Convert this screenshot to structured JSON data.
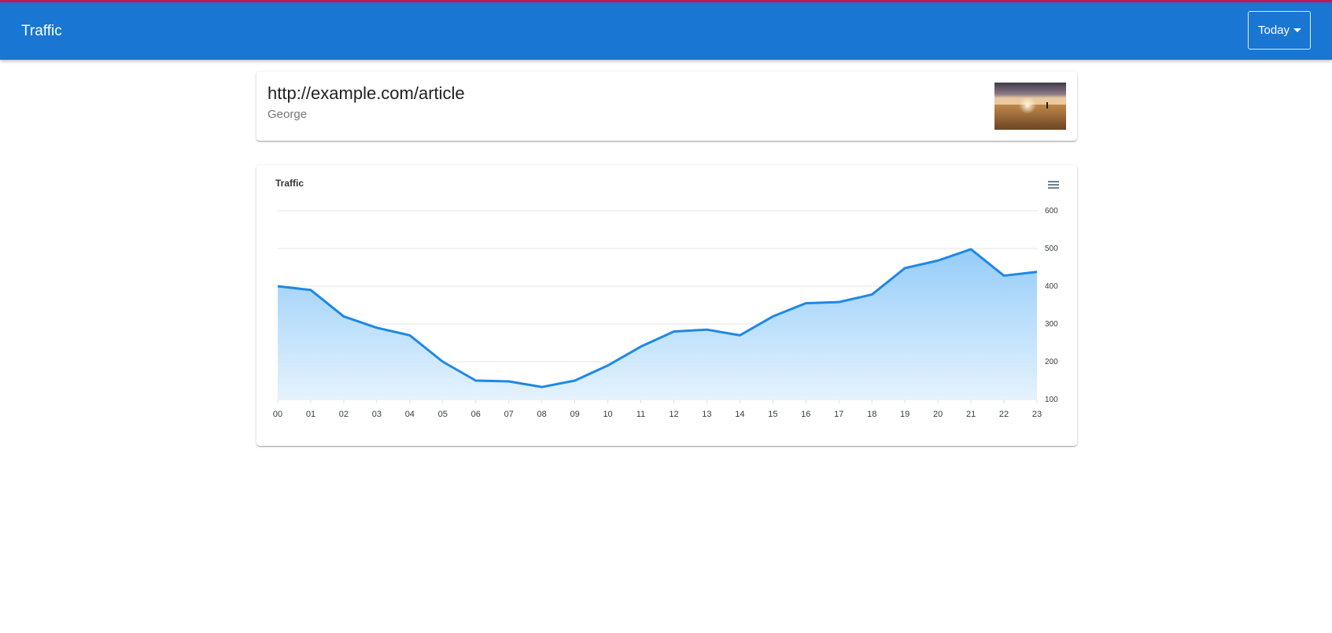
{
  "appbar": {
    "title": "Traffic",
    "range_select": {
      "value": "Today",
      "icon": "caret-down-icon"
    }
  },
  "article": {
    "url": "http://example.com/article",
    "author": "George",
    "thumbnail": "field-sunset-image"
  },
  "chart": {
    "menu_icon": "hamburger-menu-icon"
  },
  "colors": {
    "appbar": "#1976d2",
    "top_strip": "#c2185b",
    "series_line": "#1e88e5",
    "series_fill_top": "#90caf9",
    "series_fill_bottom": "#e3f2fd"
  },
  "chart_data": {
    "type": "area",
    "title": "Traffic",
    "xlabel": "",
    "ylabel": "",
    "categories": [
      "00",
      "01",
      "02",
      "03",
      "04",
      "05",
      "06",
      "07",
      "08",
      "09",
      "10",
      "11",
      "12",
      "13",
      "14",
      "15",
      "16",
      "17",
      "18",
      "19",
      "20",
      "21",
      "22",
      "23"
    ],
    "series": [
      {
        "values": [
          400,
          390,
          320,
          290,
          270,
          200,
          150,
          148,
          133,
          150,
          190,
          240,
          280,
          285,
          270,
          320,
          355,
          358,
          378,
          448,
          468,
          498,
          428,
          438
        ]
      }
    ],
    "ylim": [
      100,
      600
    ],
    "yticks": [
      "600",
      "500",
      "400",
      "300",
      "200",
      "100"
    ],
    "y_axis_position": "right",
    "grid": true,
    "legend": "none"
  }
}
